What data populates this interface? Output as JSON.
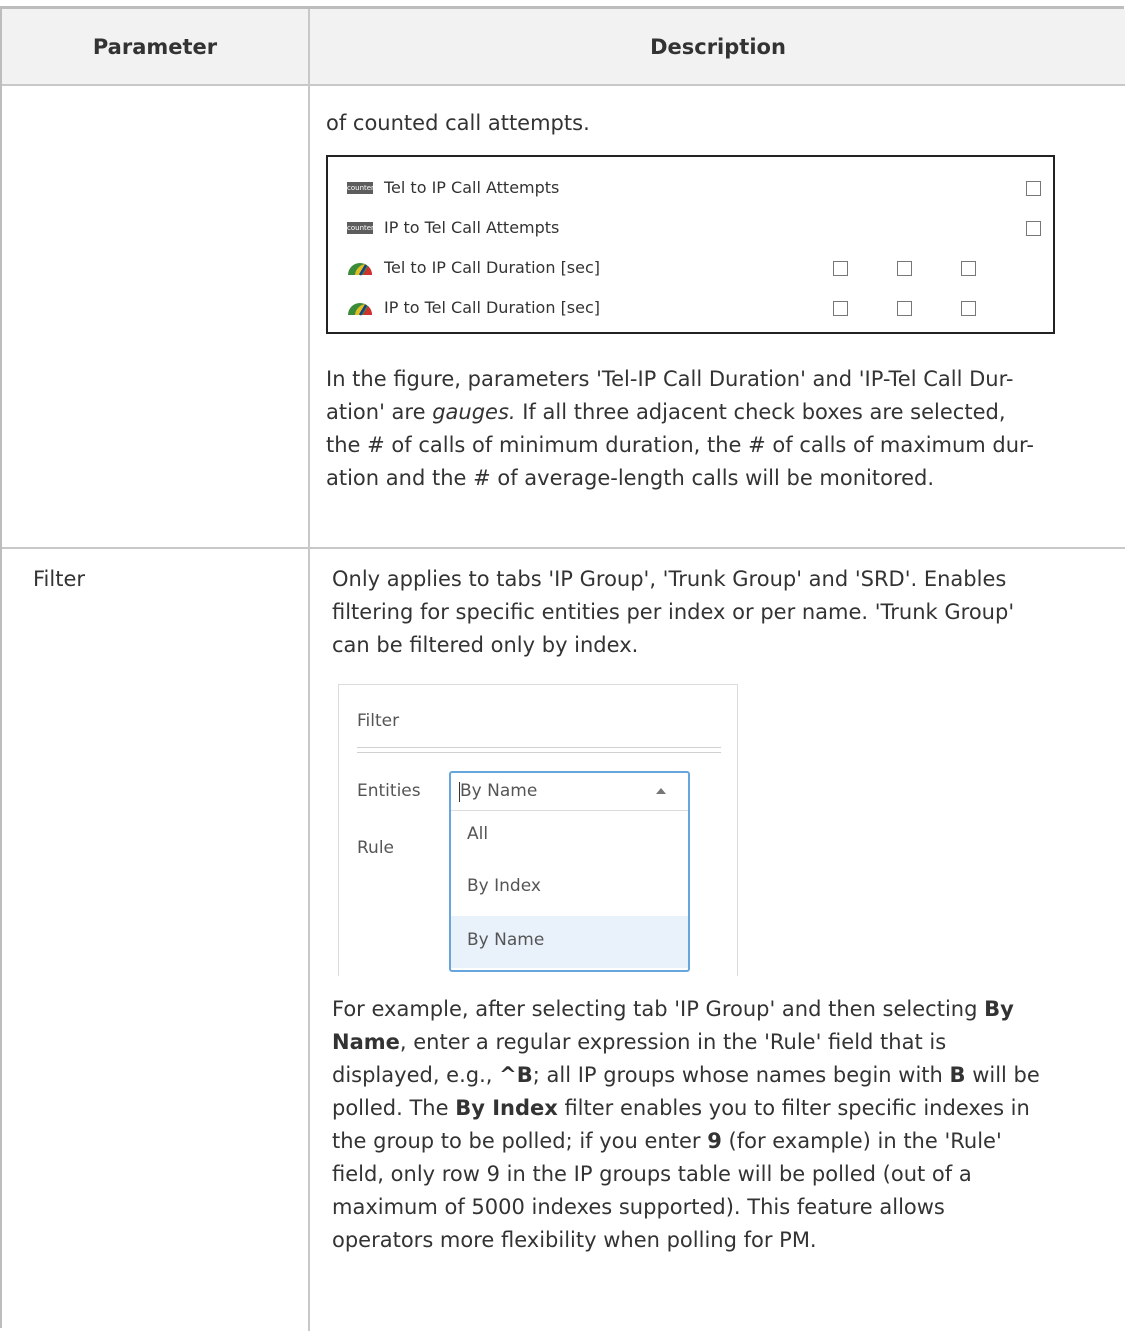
{
  "table": {
    "header": {
      "parameter": "Parameter",
      "description": "Description"
    }
  },
  "row1": {
    "lead": "of counted call attempts.",
    "counters": [
      {
        "icon": "counter-icon",
        "label": "Tel to IP Call Attempts"
      },
      {
        "icon": "counter-icon",
        "label": "IP to Tel Call Attempts"
      },
      {
        "icon": "gauge-icon",
        "label": "Tel to IP Call Duration [sec]"
      },
      {
        "icon": "gauge-icon",
        "label": "IP to Tel Call Duration [sec]"
      }
    ],
    "counter_icon_text": "counter",
    "para": [
      "In the figure, parameters 'Tel-IP Call Duration' and 'IP-Tel Call Dur-",
      "ation' are ",
      "gauges.",
      " If all three adjacent check boxes are selected,",
      "the # of calls of minimum duration, the # of calls of maximum dur-",
      "ation and the # of average-length calls will be monitored."
    ]
  },
  "row2": {
    "parameter": "Filter",
    "intro": [
      "Only applies to tabs 'IP Group', 'Trunk Group' and 'SRD'. Enables",
      "filtering for specific entities per index or per name. 'Trunk Group'",
      "can be filtered only by index."
    ],
    "figure": {
      "title": "Filter",
      "entities_label": "Entities",
      "rule_label": "Rule",
      "selected": "By Name",
      "options": [
        "All",
        "By Index",
        "By Name"
      ]
    },
    "example": {
      "l1a": "For example, after selecting tab 'IP Group' and then selecting ",
      "l1b": "By",
      "l2a": "Name",
      "l2b": ", enter a regular expression in the 'Rule' field that is",
      "l3a": "displayed, e.g., ",
      "l3b": "^B",
      "l3c": "; all IP groups whose names begin with ",
      "l3d": "B",
      "l3e": " will be",
      "l4a": "polled. The ",
      "l4b": "By Index",
      "l4c": " filter enables you to filter specific indexes in",
      "l5a": "the group to be polled; if you enter ",
      "l5b": "9",
      "l5c": " (for example) in the 'Rule'",
      "l6": "field, only row 9 in the IP groups table will be polled (out of a",
      "l7": "maximum of 5000 indexes supported). This feature allows",
      "l8": "operators more flexibility when polling for PM."
    }
  },
  "colors": {
    "header_bg": "#f2f2f2",
    "border": "#c8c8c8",
    "dropdown_focus": "#66a6dc",
    "highlight": "#e9f2fb"
  }
}
